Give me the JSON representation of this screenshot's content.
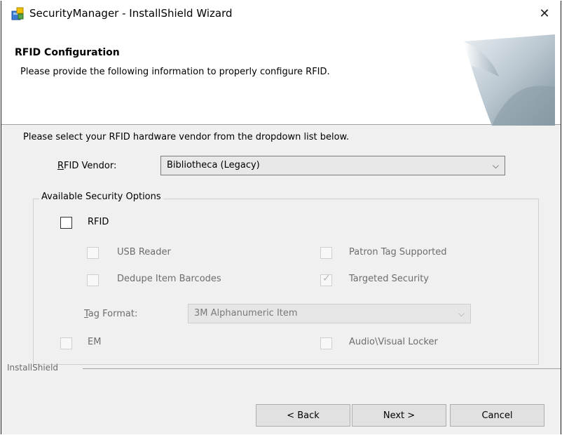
{
  "window": {
    "title": "SecurityManager - InstallShield Wizard",
    "close_glyph": "✕"
  },
  "header": {
    "title": "RFID Configuration",
    "subtitle": "Please provide the following information to properly configure RFID."
  },
  "body": {
    "instruction": "Please select your RFID hardware vendor from the dropdown list below.",
    "vendor_label_prefix": "R",
    "vendor_label_rest": "FID Vendor:",
    "vendor_value": "Bibliotheca (Legacy)"
  },
  "security_options": {
    "legend": "Available Security Options",
    "rfid": {
      "label": "RFID",
      "checked": false,
      "enabled": true
    },
    "usb_reader": {
      "label": "USB Reader",
      "checked": false,
      "enabled": false
    },
    "patron_tag": {
      "label": "Patron Tag Supported",
      "checked": false,
      "enabled": false
    },
    "dedupe": {
      "label": "Dedupe Item Barcodes",
      "checked": false,
      "enabled": false
    },
    "targeted": {
      "label": "Targeted Security",
      "checked": true,
      "enabled": false
    },
    "tag_format_label_prefix": "T",
    "tag_format_label_rest": "ag Format:",
    "tag_format_value": "3M Alphanumeric Item",
    "em": {
      "label": "EM",
      "checked": false,
      "enabled": false
    },
    "av_locker": {
      "label": "Audio\\Visual Locker",
      "checked": false,
      "enabled": false
    }
  },
  "footer": {
    "brand": "InstallShield",
    "back": "< Back",
    "next": "Next >",
    "cancel": "Cancel"
  },
  "icons": {
    "app": "installer-icon",
    "close": "close-icon",
    "dropdown": "chevron-down-icon"
  }
}
